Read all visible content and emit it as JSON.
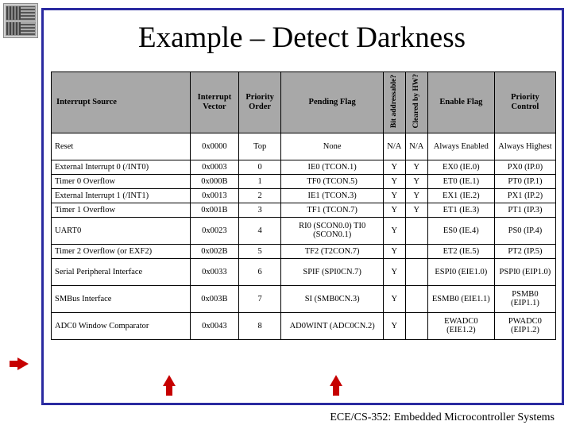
{
  "title": "Example – Detect Darkness",
  "footer": "ECE/CS-352: Embedded Microcontroller Systems",
  "headers": {
    "src": "Interrupt Source",
    "vec": "Interrupt Vector",
    "pri": "Priority Order",
    "flag": "Pending Flag",
    "bit": "Bit addressable?",
    "hw": "Cleared by HW?",
    "en": "Enable Flag",
    "pc": "Priority Control"
  },
  "rows": [
    {
      "src": "Reset",
      "vec": "0x0000",
      "pri": "Top",
      "flag": "None",
      "bit": "N/A",
      "hw": "N/A",
      "en": "Always Enabled",
      "pc": "Always Highest",
      "tall": true
    },
    {
      "src": "External Interrupt 0 (/INT0)",
      "vec": "0x0003",
      "pri": "0",
      "flag": "IE0 (TCON.1)",
      "bit": "Y",
      "hw": "Y",
      "en": "EX0 (IE.0)",
      "pc": "PX0 (IP.0)"
    },
    {
      "src": "Timer 0 Overflow",
      "vec": "0x000B",
      "pri": "1",
      "flag": "TF0 (TCON.5)",
      "bit": "Y",
      "hw": "Y",
      "en": "ET0 (IE.1)",
      "pc": "PT0 (IP.1)"
    },
    {
      "src": "External Interrupt 1 (/INT1)",
      "vec": "0x0013",
      "pri": "2",
      "flag": "IE1 (TCON.3)",
      "bit": "Y",
      "hw": "Y",
      "en": "EX1 (IE.2)",
      "pc": "PX1 (IP.2)"
    },
    {
      "src": "Timer 1 Overflow",
      "vec": "0x001B",
      "pri": "3",
      "flag": "TF1 (TCON.7)",
      "bit": "Y",
      "hw": "Y",
      "en": "ET1 (IE.3)",
      "pc": "PT1 (IP.3)"
    },
    {
      "src": "UART0",
      "vec": "0x0023",
      "pri": "4",
      "flag": "RI0 (SCON0.0) TI0 (SCON0.1)",
      "bit": "Y",
      "hw": "",
      "en": "ES0 (IE.4)",
      "pc": "PS0 (IP.4)",
      "tall": true
    },
    {
      "src": "Timer 2 Overflow (or EXF2)",
      "vec": "0x002B",
      "pri": "5",
      "flag": "TF2 (T2CON.7)",
      "bit": "Y",
      "hw": "",
      "en": "ET2 (IE.5)",
      "pc": "PT2 (IP.5)"
    },
    {
      "src": "Serial Peripheral Interface",
      "vec": "0x0033",
      "pri": "6",
      "flag": "SPIF (SPI0CN.7)",
      "bit": "Y",
      "hw": "",
      "en": "ESPI0 (EIE1.0)",
      "pc": "PSPI0 (EIP1.0)",
      "tall": true
    },
    {
      "src": "SMBus Interface",
      "vec": "0x003B",
      "pri": "7",
      "flag": "SI (SMB0CN.3)",
      "bit": "Y",
      "hw": "",
      "en": "ESMB0 (EIE1.1)",
      "pc": "PSMB0 (EIP1.1)",
      "tall": true
    },
    {
      "src": "ADC0 Window Comparator",
      "vec": "0x0043",
      "pri": "8",
      "flag": "AD0WINT (ADC0CN.2)",
      "bit": "Y",
      "hw": "",
      "en": "EWADC0 (EIE1.2)",
      "pc": "PWADC0 (EIP1.2)",
      "tall": true
    }
  ]
}
